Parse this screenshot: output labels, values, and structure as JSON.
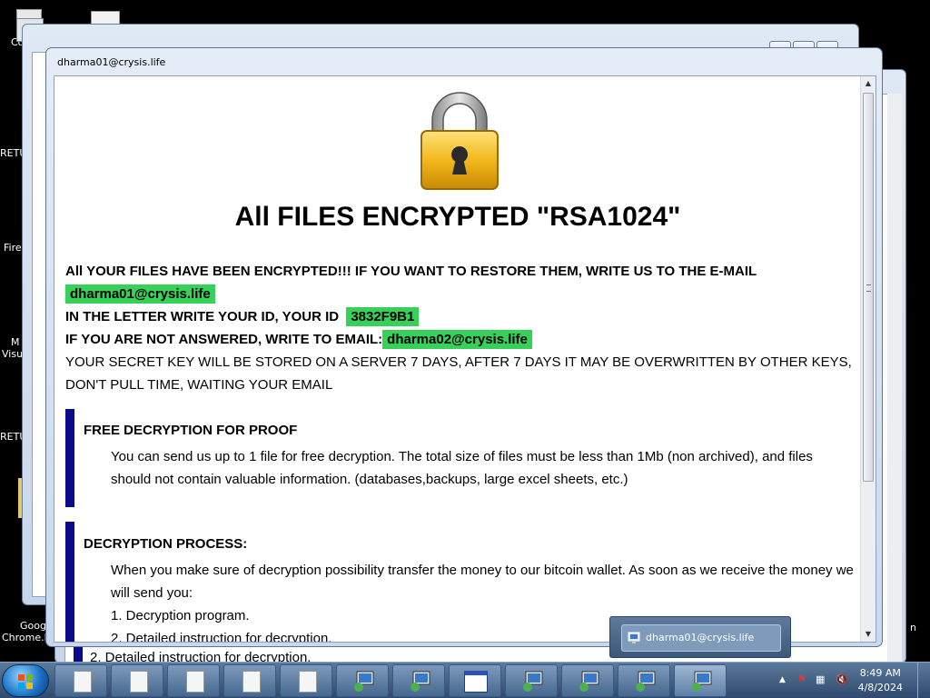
{
  "desktop": {
    "icons": [
      {
        "label": "Co"
      },
      {
        "label": "RETU"
      },
      {
        "label": "Firef"
      },
      {
        "label": "M"
      },
      {
        "label": "Visu"
      },
      {
        "label": "RETU"
      },
      {
        "label": "Goog"
      },
      {
        "label": "Chrome.l"
      }
    ],
    "right_edge_label": "n"
  },
  "window": {
    "title": "dharma01@crysis.life"
  },
  "note": {
    "headline": "All FILES ENCRYPTED \"RSA1024\"",
    "line1": "All YOUR FILES HAVE BEEN ENCRYPTED!!! IF YOU WANT TO RESTORE THEM, WRITE US TO THE E-MAIL",
    "email1": "dharma01@crysis.life",
    "id_prefix": "IN THE LETTER WRITE YOUR ID, YOUR ID",
    "id_value": "3832F9B1",
    "alt_prefix": "IF YOU ARE NOT ANSWERED, WRITE TO EMAIL:",
    "email2": "dharma02@crysis.life",
    "secret1": "YOUR SECRET KEY WILL BE STORED ON A SERVER 7 DAYS, AFTER 7 DAYS IT MAY BE OVERWRITTEN BY OTHER KEYS,",
    "secret2": "DON'T PULL TIME, WAITING YOUR EMAIL",
    "section1": {
      "title": "FREE DECRYPTION FOR PROOF",
      "line1": "You can send us up to 1 file for free decryption. The total size of files must be less than 1Mb (non archived), and files",
      "line2": "should not contain valuable information. (databases,backups, large excel sheets, etc.)"
    },
    "section2": {
      "title": "DECRYPTION PROCESS:",
      "line1": "When you make sure of decryption possibility transfer the money to our bitcoin wallet. As soon as we receive the money we",
      "line2": "will send you:",
      "item1": "1. Decryption program.",
      "item2": "2. Detailed instruction for decryption."
    },
    "behind_text": "2. Detailed instruction for decryption."
  },
  "taskbar": {
    "popup_title": "dharma01@crysis.life",
    "clock_time": "8:49 AM",
    "clock_date": "4/8/2024"
  },
  "colors": {
    "highlight": "#37d15a",
    "section_bar": "#0a0a8a",
    "lock_gold": "#f2b81c"
  }
}
